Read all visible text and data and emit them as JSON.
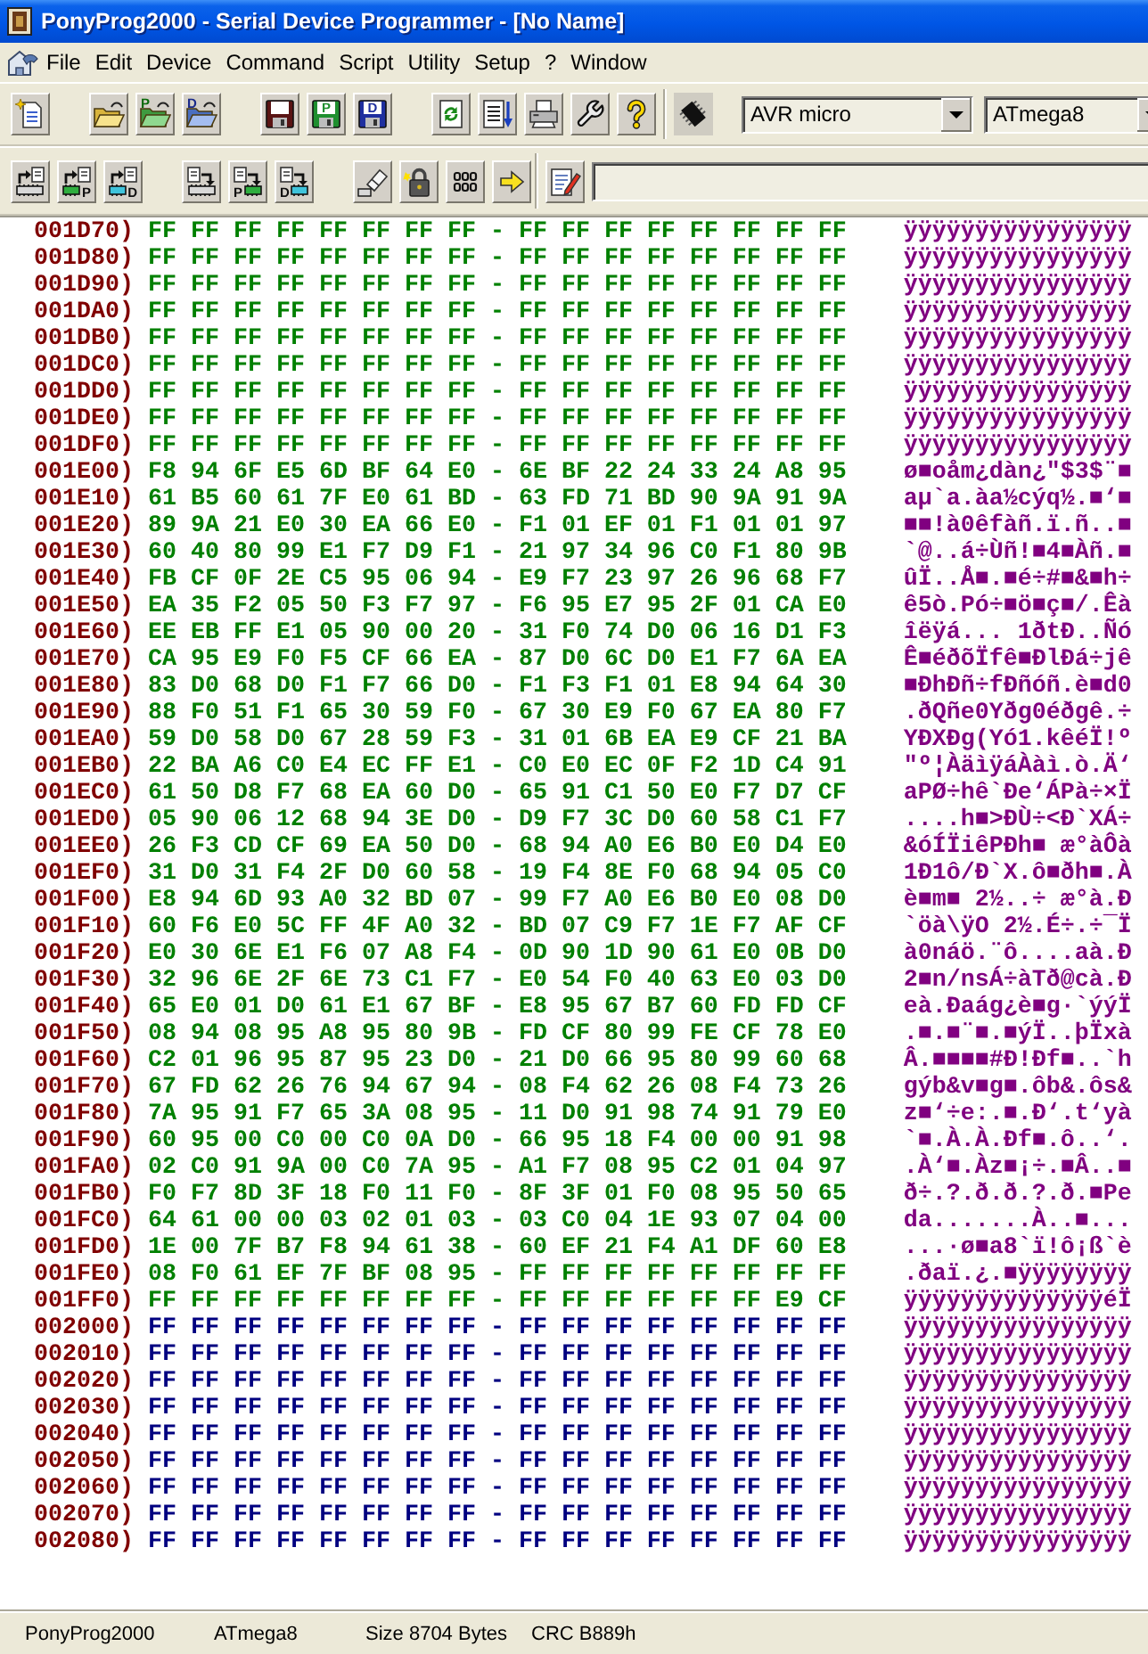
{
  "window": {
    "title": "PonyProg2000 - Serial Device Programmer - [No Name]"
  },
  "menu_bar": {
    "items": [
      "File",
      "Edit",
      "Device",
      "Command",
      "Script",
      "Utility",
      "Setup",
      "?",
      "Window"
    ]
  },
  "toolbar_top": {
    "button_groups": [
      [
        {
          "kind": "new"
        }
      ],
      [
        {
          "kind": "open"
        },
        {
          "kind": "open_program",
          "letter": "P"
        },
        {
          "kind": "open_data",
          "letter": "D"
        }
      ],
      [
        {
          "kind": "save"
        },
        {
          "kind": "save_program",
          "letter": "P"
        },
        {
          "kind": "save_data",
          "letter": "D"
        }
      ],
      [
        {
          "kind": "reload"
        },
        {
          "kind": "edit"
        },
        {
          "kind": "print"
        },
        {
          "kind": "setup"
        },
        {
          "kind": "help"
        }
      ]
    ],
    "device_family": "AVR micro",
    "device": "ATmega8"
  },
  "toolbar_bottom": {
    "button_groups": [
      [
        {
          "kind": "read_all"
        },
        {
          "kind": "read_program",
          "letter": "P"
        },
        {
          "kind": "read_data",
          "letter": "D"
        }
      ],
      [
        {
          "kind": "write_all"
        },
        {
          "kind": "write_program",
          "letter": "P"
        },
        {
          "kind": "write_data",
          "letter": "D"
        }
      ],
      [
        {
          "kind": "erase"
        },
        {
          "kind": "security"
        },
        {
          "kind": "config"
        },
        {
          "kind": "script"
        }
      ]
    ]
  },
  "hex_view": {
    "rows": [
      {
        "address": "001D70)",
        "hex": "FF FF FF FF FF FF FF FF - FF FF FF FF FF FF FF FF",
        "ascii": "ÿÿÿÿÿÿÿÿÿÿÿÿÿÿÿÿ",
        "color": "#008000"
      },
      {
        "address": "001D80)",
        "hex": "FF FF FF FF FF FF FF FF - FF FF FF FF FF FF FF FF",
        "ascii": "ÿÿÿÿÿÿÿÿÿÿÿÿÿÿÿÿ",
        "color": "#008000"
      },
      {
        "address": "001D90)",
        "hex": "FF FF FF FF FF FF FF FF - FF FF FF FF FF FF FF FF",
        "ascii": "ÿÿÿÿÿÿÿÿÿÿÿÿÿÿÿÿ",
        "color": "#008000"
      },
      {
        "address": "001DA0)",
        "hex": "FF FF FF FF FF FF FF FF - FF FF FF FF FF FF FF FF",
        "ascii": "ÿÿÿÿÿÿÿÿÿÿÿÿÿÿÿÿ",
        "color": "#008000"
      },
      {
        "address": "001DB0)",
        "hex": "FF FF FF FF FF FF FF FF - FF FF FF FF FF FF FF FF",
        "ascii": "ÿÿÿÿÿÿÿÿÿÿÿÿÿÿÿÿ",
        "color": "#008000"
      },
      {
        "address": "001DC0)",
        "hex": "FF FF FF FF FF FF FF FF - FF FF FF FF FF FF FF FF",
        "ascii": "ÿÿÿÿÿÿÿÿÿÿÿÿÿÿÿÿ",
        "color": "#008000"
      },
      {
        "address": "001DD0)",
        "hex": "FF FF FF FF FF FF FF FF - FF FF FF FF FF FF FF FF",
        "ascii": "ÿÿÿÿÿÿÿÿÿÿÿÿÿÿÿÿ",
        "color": "#008000"
      },
      {
        "address": "001DE0)",
        "hex": "FF FF FF FF FF FF FF FF - FF FF FF FF FF FF FF FF",
        "ascii": "ÿÿÿÿÿÿÿÿÿÿÿÿÿÿÿÿ",
        "color": "#008000"
      },
      {
        "address": "001DF0)",
        "hex": "FF FF FF FF FF FF FF FF - FF FF FF FF FF FF FF FF",
        "ascii": "ÿÿÿÿÿÿÿÿÿÿÿÿÿÿÿÿ",
        "color": "#008000"
      },
      {
        "address": "001E00)",
        "hex": "F8 94 6F E5 6D BF 64 E0 - 6E BF 22 24 33 24 A8 95",
        "ascii": "ø■oåm¿dàn¿\"$3$¨■",
        "color": "#008000"
      },
      {
        "address": "001E10)",
        "hex": "61 B5 60 61 7F E0 61 BD - 63 FD 71 BD 90 9A 91 9A",
        "ascii": "aµ`a.àa½cýq½.■‘■",
        "color": "#008000"
      },
      {
        "address": "001E20)",
        "hex": "89 9A 21 E0 30 EA 66 E0 - F1 01 EF 01 F1 01 01 97",
        "ascii": "■■!à0êfàñ.ï.ñ..■",
        "color": "#008000"
      },
      {
        "address": "001E30)",
        "hex": "60 40 80 99 E1 F7 D9 F1 - 21 97 34 96 C0 F1 80 9B",
        "ascii": "`@..á÷Ùñ!■4■Àñ.■",
        "color": "#008000"
      },
      {
        "address": "001E40)",
        "hex": "FB CF 0F 2E C5 95 06 94 - E9 F7 23 97 26 96 68 F7",
        "ascii": "ûÏ..Å■.■é÷#■&■h÷",
        "color": "#008000"
      },
      {
        "address": "001E50)",
        "hex": "EA 35 F2 05 50 F3 F7 97 - F6 95 E7 95 2F 01 CA E0",
        "ascii": "ê5ò.Pó÷■ö■ç■/.Êà",
        "color": "#008000"
      },
      {
        "address": "001E60)",
        "hex": "EE EB FF E1 05 90 00 20 - 31 F0 74 D0 06 16 D1 F3",
        "ascii": "îëÿá... 1ðtÐ..Ñó",
        "color": "#008000"
      },
      {
        "address": "001E70)",
        "hex": "CA 95 E9 F0 F5 CF 66 EA - 87 D0 6C D0 E1 F7 6A EA",
        "ascii": "Ê■éðõÏfê■ÐlÐá÷jê",
        "color": "#008000"
      },
      {
        "address": "001E80)",
        "hex": "83 D0 68 D0 F1 F7 66 D0 - F1 F3 F1 01 E8 94 64 30",
        "ascii": "■ÐhÐñ÷fÐñóñ.è■d0",
        "color": "#008000"
      },
      {
        "address": "001E90)",
        "hex": "88 F0 51 F1 65 30 59 F0 - 67 30 E9 F0 67 EA 80 F7",
        "ascii": ".ðQñe0Yðg0éðgê.÷",
        "color": "#008000"
      },
      {
        "address": "001EA0)",
        "hex": "59 D0 58 D0 67 28 59 F3 - 31 01 6B EA E9 CF 21 BA",
        "ascii": "YÐXÐg(Yó1.kêéÏ!º",
        "color": "#008000"
      },
      {
        "address": "001EB0)",
        "hex": "22 BA A6 C0 E4 EC FF E1 - C0 E0 EC 0F F2 1D C4 91",
        "ascii": "\"º¦ÀäìÿáÀàì.ò.Ä‘",
        "color": "#008000"
      },
      {
        "address": "001EC0)",
        "hex": "61 50 D8 F7 68 EA 60 D0 - 65 91 C1 50 E0 F7 D7 CF",
        "ascii": "aPØ÷hê`Ðe‘ÁPà÷×Ï",
        "color": "#008000"
      },
      {
        "address": "001ED0)",
        "hex": "05 90 06 12 68 94 3E D0 - D9 F7 3C D0 60 58 C1 F7",
        "ascii": "....h■>ÐÙ÷<Ð`XÁ÷",
        "color": "#008000"
      },
      {
        "address": "001EE0)",
        "hex": "26 F3 CD CF 69 EA 50 D0 - 68 94 A0 E6 B0 E0 D4 E0",
        "ascii": "&óÍÏiêPÐh■ æ°àÔà",
        "color": "#008000"
      },
      {
        "address": "001EF0)",
        "hex": "31 D0 31 F4 2F D0 60 58 - 19 F4 8E F0 68 94 05 C0",
        "ascii": "1Ð1ô/Ð`X.ô■ðh■.À",
        "color": "#008000"
      },
      {
        "address": "001F00)",
        "hex": "E8 94 6D 93 A0 32 BD 07 - 99 F7 A0 E6 B0 E0 08 D0",
        "ascii": "è■m■ 2½..÷ æ°à.Ð",
        "color": "#008000"
      },
      {
        "address": "001F10)",
        "hex": "60 F6 E0 5C FF 4F A0 32 - BD 07 C9 F7 1E F7 AF CF",
        "ascii": "`öà\\ÿO 2½.É÷.÷¯Ï",
        "color": "#008000"
      },
      {
        "address": "001F20)",
        "hex": "E0 30 6E E1 F6 07 A8 F4 - 0D 90 1D 90 61 E0 0B D0",
        "ascii": "à0náö.¨ô....aà.Ð",
        "color": "#008000"
      },
      {
        "address": "001F30)",
        "hex": "32 96 6E 2F 6E 73 C1 F7 - E0 54 F0 40 63 E0 03 D0",
        "ascii": "2■n/nsÁ÷àTð@cà.Ð",
        "color": "#008000"
      },
      {
        "address": "001F40)",
        "hex": "65 E0 01 D0 61 E1 67 BF - E8 95 67 B7 60 FD FD CF",
        "ascii": "eà.Ðaág¿è■g·`ýýÏ",
        "color": "#008000"
      },
      {
        "address": "001F50)",
        "hex": "08 94 08 95 A8 95 80 9B - FD CF 80 99 FE CF 78 E0",
        "ascii": ".■.■¨■.■ýÏ..þÏxà",
        "color": "#008000"
      },
      {
        "address": "001F60)",
        "hex": "C2 01 96 95 87 95 23 D0 - 21 D0 66 95 80 99 60 68",
        "ascii": "Â.■■■■#Ð!Ðf■..`h",
        "color": "#008000"
      },
      {
        "address": "001F70)",
        "hex": "67 FD 62 26 76 94 67 94 - 08 F4 62 26 08 F4 73 26",
        "ascii": "gýb&v■g■.ôb&.ôs&",
        "color": "#008000"
      },
      {
        "address": "001F80)",
        "hex": "7A 95 91 F7 65 3A 08 95 - 11 D0 91 98 74 91 79 E0",
        "ascii": "z■‘÷e:.■.Ð‘.t‘yà",
        "color": "#008000"
      },
      {
        "address": "001F90)",
        "hex": "60 95 00 C0 00 C0 0A D0 - 66 95 18 F4 00 00 91 98",
        "ascii": "`■.À.À.Ðf■.ô..‘.",
        "color": "#008000"
      },
      {
        "address": "001FA0)",
        "hex": "02 C0 91 9A 00 C0 7A 95 - A1 F7 08 95 C2 01 04 97",
        "ascii": ".À‘■.Àz■¡÷.■Â..■",
        "color": "#008000"
      },
      {
        "address": "001FB0)",
        "hex": "F0 F7 8D 3F 18 F0 11 F0 - 8F 3F 01 F0 08 95 50 65",
        "ascii": "ð÷.?.ð.ð.?.ð.■Pe",
        "color": "#008000"
      },
      {
        "address": "001FC0)",
        "hex": "64 61 00 00 03 02 01 03 - 03 C0 04 1E 93 07 04 00",
        "ascii": "da.......À..■...",
        "color": "#008000"
      },
      {
        "address": "001FD0)",
        "hex": "1E 00 7F B7 F8 94 61 38 - 60 EF 21 F4 A1 DF 60 E8",
        "ascii": "...·ø■a8`ï!ô¡ß`è",
        "color": "#008000"
      },
      {
        "address": "001FE0)",
        "hex": "08 F0 61 EF 7F BF 08 95 - FF FF FF FF FF FF FF FF",
        "ascii": ".ðaï.¿.■ÿÿÿÿÿÿÿÿ",
        "color": "#008000"
      },
      {
        "address": "001FF0)",
        "hex": "FF FF FF FF FF FF FF FF - FF FF FF FF FF FF E9 CF",
        "ascii": "ÿÿÿÿÿÿÿÿÿÿÿÿÿÿéÏ",
        "color": "#008000"
      },
      {
        "address": "002000)",
        "hex": "FF FF FF FF FF FF FF FF - FF FF FF FF FF FF FF FF",
        "ascii": "ÿÿÿÿÿÿÿÿÿÿÿÿÿÿÿÿ",
        "color": "#000080"
      },
      {
        "address": "002010)",
        "hex": "FF FF FF FF FF FF FF FF - FF FF FF FF FF FF FF FF",
        "ascii": "ÿÿÿÿÿÿÿÿÿÿÿÿÿÿÿÿ",
        "color": "#000080"
      },
      {
        "address": "002020)",
        "hex": "FF FF FF FF FF FF FF FF - FF FF FF FF FF FF FF FF",
        "ascii": "ÿÿÿÿÿÿÿÿÿÿÿÿÿÿÿÿ",
        "color": "#000080"
      },
      {
        "address": "002030)",
        "hex": "FF FF FF FF FF FF FF FF - FF FF FF FF FF FF FF FF",
        "ascii": "ÿÿÿÿÿÿÿÿÿÿÿÿÿÿÿÿ",
        "color": "#000080"
      },
      {
        "address": "002040)",
        "hex": "FF FF FF FF FF FF FF FF - FF FF FF FF FF FF FF FF",
        "ascii": "ÿÿÿÿÿÿÿÿÿÿÿÿÿÿÿÿ",
        "color": "#000080"
      },
      {
        "address": "002050)",
        "hex": "FF FF FF FF FF FF FF FF - FF FF FF FF FF FF FF FF",
        "ascii": "ÿÿÿÿÿÿÿÿÿÿÿÿÿÿÿÿ",
        "color": "#000080"
      },
      {
        "address": "002060)",
        "hex": "FF FF FF FF FF FF FF FF - FF FF FF FF FF FF FF FF",
        "ascii": "ÿÿÿÿÿÿÿÿÿÿÿÿÿÿÿÿ",
        "color": "#000080"
      },
      {
        "address": "002070)",
        "hex": "FF FF FF FF FF FF FF FF - FF FF FF FF FF FF FF FF",
        "ascii": "ÿÿÿÿÿÿÿÿÿÿÿÿÿÿÿÿ",
        "color": "#000080"
      },
      {
        "address": "002080)",
        "hex": "FF FF FF FF FF FF FF FF - FF FF FF FF FF FF FF FF",
        "ascii": "ÿÿÿÿÿÿÿÿÿÿÿÿÿÿÿÿ",
        "color": "#000080"
      }
    ]
  },
  "status_bar": {
    "items": [
      "PonyProg2000",
      "ATmega8",
      "Size 8704 Bytes",
      "CRC B889h"
    ]
  }
}
